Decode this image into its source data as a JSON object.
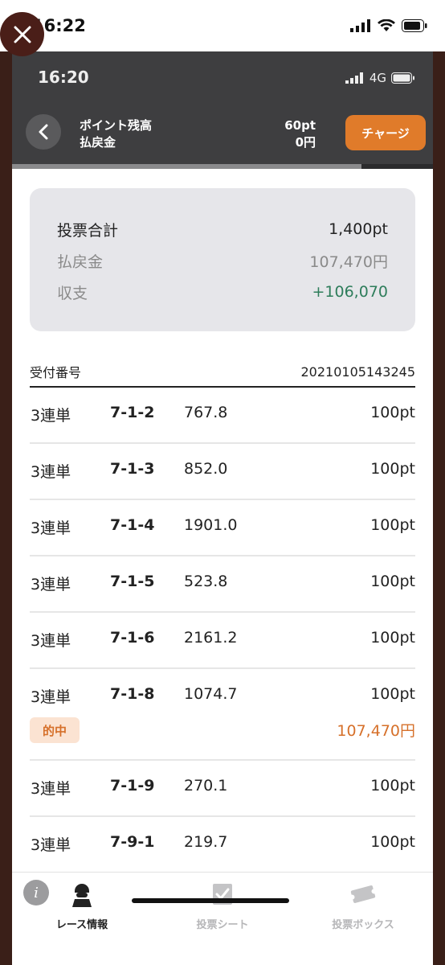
{
  "outer_status": {
    "time": "16:22"
  },
  "inner_status": {
    "time": "16:20",
    "network": "4G"
  },
  "header": {
    "point_label": "ポイント残高",
    "refund_label": "払戻金",
    "point_value": "60pt",
    "refund_value": "0円",
    "charge_button": "チャージ",
    "progress": 0.83
  },
  "summary": {
    "total_label": "投票合計",
    "total_value": "1,400pt",
    "refund_label": "払戻金",
    "refund_value": "107,470円",
    "balance_label": "収支",
    "balance_value": "+106,070"
  },
  "receipt": {
    "label": "受付番号",
    "number": "20210105143245"
  },
  "bets": [
    {
      "type": "3連単",
      "combo": "7-1-2",
      "odds": "767.8",
      "amount": "100pt"
    },
    {
      "type": "3連単",
      "combo": "7-1-3",
      "odds": "852.0",
      "amount": "100pt"
    },
    {
      "type": "3連単",
      "combo": "7-1-4",
      "odds": "1901.0",
      "amount": "100pt"
    },
    {
      "type": "3連単",
      "combo": "7-1-5",
      "odds": "523.8",
      "amount": "100pt"
    },
    {
      "type": "3連単",
      "combo": "7-1-6",
      "odds": "2161.2",
      "amount": "100pt"
    },
    {
      "type": "3連単",
      "combo": "7-1-8",
      "odds": "1074.7",
      "amount": "100pt",
      "hit_label": "的中",
      "payout": "107,470円"
    },
    {
      "type": "3連単",
      "combo": "7-1-9",
      "odds": "270.1",
      "amount": "100pt"
    },
    {
      "type": "3連単",
      "combo": "7-9-1",
      "odds": "219.7",
      "amount": "100pt"
    }
  ],
  "nav": {
    "info_icon": "i",
    "items": [
      {
        "label": "レース情報",
        "icon": "jockey-icon",
        "active": true
      },
      {
        "label": "投票シート",
        "icon": "checkmark-sheet-icon",
        "active": false
      },
      {
        "label": "投票ボックス",
        "icon": "ticket-icon",
        "active": false
      }
    ]
  },
  "colors": {
    "accent": "#e07b2a",
    "frame": "#3a1f18",
    "header_bg": "#3e3e40",
    "positive": "#2e7d5b",
    "hit": "#d6702a"
  }
}
